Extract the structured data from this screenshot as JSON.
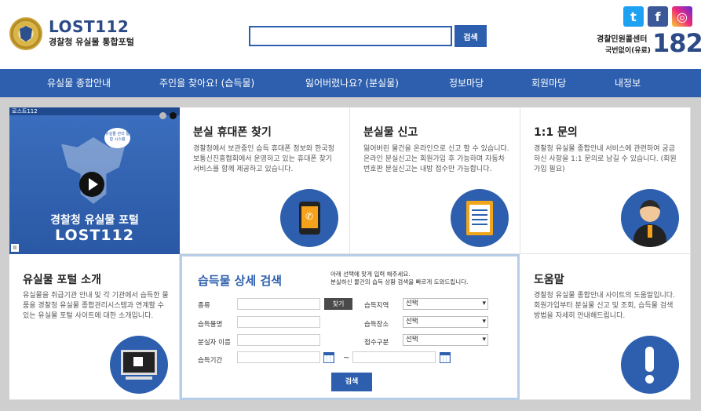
{
  "header": {
    "logo_title": "LOST112",
    "logo_subtitle": "경찰청 유실물 통합포털",
    "search_button": "검색",
    "social": {
      "twitter": "t",
      "facebook": "f",
      "instagram": "◎"
    },
    "call_center_label": "경찰민원콜센터",
    "call_center_sub": "국번없이(유료)",
    "call_center_number": "182"
  },
  "nav": {
    "items": [
      "유실물 종합안내",
      "주인을 찾아요! (습득물)",
      "잃어버렸나요? (분실물)",
      "정보마당",
      "회원마당",
      "내정보"
    ]
  },
  "video": {
    "top_label": "로스트112",
    "title_line1": "경찰청 유실물 포털",
    "title_line2": "LOST112",
    "badge": "유실물 관리 통합 시스템",
    "pause_label": "II"
  },
  "cards": {
    "phone": {
      "title": "분실 휴대폰 찾기",
      "desc": "경찰청에서 보관중인 습득 휴대폰 정보와 한국정보통신진흥협회에서 운영하고 있는 휴대폰 찾기 서비스를 함께 제공하고 있습니다."
    },
    "report": {
      "title": "분실물 신고",
      "desc": "잃어버린 물건을 온라인으로 신고 할 수 있습니다. 온라인 분실신고는 회원가입 후 가능하며 자동차 번호판 분실신고는 내방 접수만 가능합니다."
    },
    "inquiry": {
      "title": "1:1 문의",
      "desc": "경찰청 유실물 종합안내 서비스에 관련하여 궁금하신 사항을 1:1 문의로 남길 수 있습니다. (회원가입 필요)"
    },
    "intro": {
      "title": "유실물 포털 소개",
      "desc": "유실물을 취급기관 안내 및 각 기관에서 습득한 물품을 경찰청 유실물 종합관리시스템과 연계할 수 있는 유실물 포털 사이트에 대한 소개입니다."
    },
    "help": {
      "title": "도움말",
      "desc": "경찰청 유실물 종합안내 사이트의 도움말입니다. 회원가입부터 분실물 신고 및 조회, 습득물 검색 방법을 자세히 안내해드립니다."
    }
  },
  "search_panel": {
    "title": "습득물 상세 검색",
    "note_line1": "아래 선택에 맞게 입력 해주세요.",
    "note_line2": "분실하신 물건의 습득 상황 검색을 빠르게 도와드립니다.",
    "labels": {
      "kind": "종류",
      "item_name": "습득물명",
      "loser_name": "분실자 이름",
      "period": "습득기간",
      "area": "습득지역",
      "place": "습득장소",
      "receipt": "접수구분"
    },
    "find_button": "찾기",
    "select_default": "선택",
    "tilde": "~",
    "search_button": "검색"
  },
  "colors": {
    "primary": "#2d5fae",
    "title": "#2b4a86"
  }
}
